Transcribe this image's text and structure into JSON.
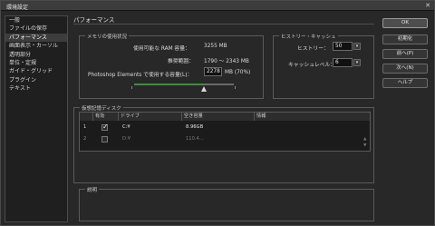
{
  "window": {
    "title": "環境設定",
    "close_label": "✕"
  },
  "sidebar": {
    "items": [
      {
        "label": "一般"
      },
      {
        "label": "ファイルの保存"
      },
      {
        "label": "パフォーマンス"
      },
      {
        "label": "画面表示・カーソル"
      },
      {
        "label": "透明部分"
      },
      {
        "label": "単位・定規"
      },
      {
        "label": "ガイド・グリッド"
      },
      {
        "label": "プラグイン"
      },
      {
        "label": "テキスト"
      }
    ],
    "active_index": 2
  },
  "main": {
    "title": "パフォーマンス",
    "memory": {
      "legend": "メモリの使用状況",
      "available_label": "使用可能な RAM 容量：",
      "available_value": "3255 MB",
      "ideal_label": "推奨範囲：",
      "ideal_value": "1790 ～ 2343 MB",
      "use_label": "Photoshop Elements で使用する容量(L)：",
      "use_value": "2278",
      "use_unit": "MB (70%)",
      "slider_level": 0.7
    },
    "history": {
      "legend": "ヒストリー・キャッシュ",
      "states_label": "ヒストリー：",
      "states_value": "50",
      "cache_label": "キャッシュレベル：",
      "cache_value": "6"
    },
    "scratch": {
      "legend": "仮想記憶ディスク",
      "headers": [
        "有効",
        "ドライブ",
        "空き容量",
        "情報"
      ],
      "rows": [
        {
          "num": "1",
          "checked": true,
          "drive": "C:¥",
          "free": "8.96GB",
          "info": ""
        },
        {
          "num": "2",
          "checked": false,
          "drive": "D:¥",
          "free": "110.4...",
          "info": ""
        }
      ]
    },
    "description": {
      "legend": "説明"
    }
  },
  "buttons": {
    "ok": "OK",
    "reset": "初期化",
    "prev": "前へ(P)",
    "next": "次へ(N)",
    "help": "ヘルプ"
  },
  "colors": {
    "accent": "#3f8f3f",
    "panel_bg": "#282828",
    "border": "#5a5a5a"
  }
}
